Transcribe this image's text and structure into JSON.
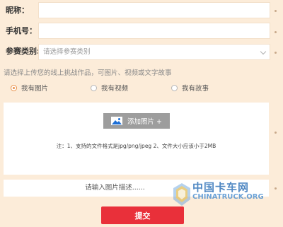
{
  "form": {
    "nickname_label": "昵称：",
    "nickname_value": "",
    "phone_label": "手机号：",
    "phone_value": "",
    "category_label": "参赛类别:",
    "category_placeholder": "请选择参赛类别",
    "upload_hint": "请选择上传您的线上挑战作品，可图片、视频或文字故事",
    "options": [
      {
        "label": "我有图片",
        "checked": true
      },
      {
        "label": "我有视频",
        "checked": false
      },
      {
        "label": "我有故事",
        "checked": false
      }
    ],
    "add_photo_label": "添加照片 +",
    "upload_note": "注：1、支持的文件格式是jpg/png/jpeg 2、文件大小应该小于2MB",
    "description_placeholder": "请输入图片描述......",
    "submit_label": "提交"
  },
  "watermark": {
    "name_cn": "中国卡车网",
    "name_en": "CHINATRUCK.ORG"
  },
  "colors": {
    "page_background": "#fcecd9",
    "submit": "#e9303a",
    "radio_accent": "#e8914a",
    "add_photo_button": "#9d9d9d"
  }
}
